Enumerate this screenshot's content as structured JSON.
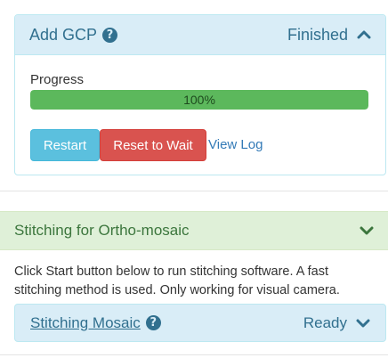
{
  "add_gcp": {
    "title": "Add GCP",
    "help_icon": "question-circle-icon",
    "status": "Finished",
    "toggle_icon": "chevron-up-icon",
    "progress_label": "Progress",
    "progress_text": "100%",
    "progress_fraction": 1.0,
    "restart_label": "Restart",
    "reset_label": "Reset to Wait",
    "view_log_label": "View Log"
  },
  "stitching": {
    "title": "Stitching for Ortho-mosaic",
    "toggle_icon": "chevron-down-icon",
    "description": "Click Start button below to run stitching software. A fast stitching method is used. Only working for visual camera."
  },
  "mosaic": {
    "title": "Stitching Mosaic",
    "help_icon": "question-circle-icon",
    "status": "Ready",
    "toggle_icon": "chevron-down-icon"
  },
  "colors": {
    "info_bg": "#d9edf7",
    "info_text": "#31708f",
    "success_bg": "#dff0d8",
    "success_text": "#3c763d",
    "progress_fill": "#5cb85c",
    "btn_info": "#5bc0de",
    "btn_danger": "#d9534f",
    "link": "#337ab7"
  }
}
